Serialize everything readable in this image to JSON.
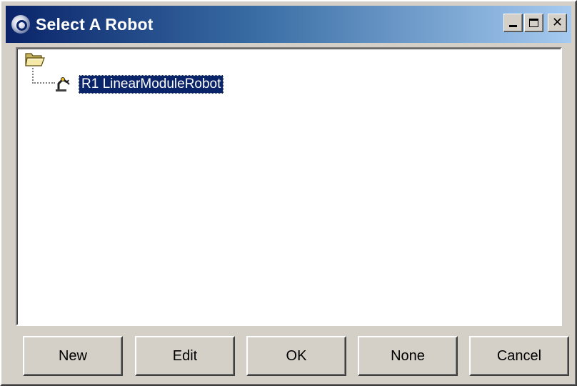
{
  "window": {
    "title": "Select A Robot",
    "controls": {
      "minimize": "minimize-icon",
      "maximize": "maximize-icon",
      "close": "close-icon"
    }
  },
  "tree": {
    "root": {
      "icon": "folder-open-icon"
    },
    "items": [
      {
        "label": "R1 LinearModuleRobot",
        "icon": "robot-arm-icon",
        "selected": true
      }
    ]
  },
  "buttons": {
    "new": "New",
    "edit": "Edit",
    "ok": "OK",
    "none": "None",
    "cancel": "Cancel"
  },
  "colors": {
    "titlebar_start": "#0a246a",
    "titlebar_end": "#a6caf0",
    "selection": "#0a246a",
    "face": "#d4d0c8"
  }
}
